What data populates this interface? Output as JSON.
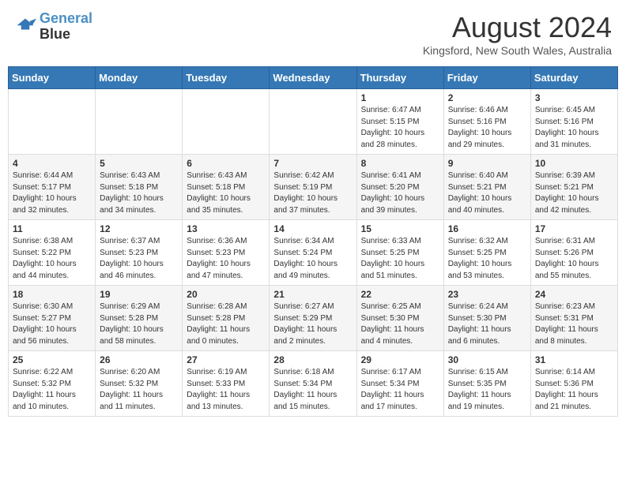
{
  "logo": {
    "line1": "General",
    "line2": "Blue"
  },
  "title": "August 2024",
  "location": "Kingsford, New South Wales, Australia",
  "days_header": [
    "Sunday",
    "Monday",
    "Tuesday",
    "Wednesday",
    "Thursday",
    "Friday",
    "Saturday"
  ],
  "weeks": [
    [
      {
        "day": "",
        "text": ""
      },
      {
        "day": "",
        "text": ""
      },
      {
        "day": "",
        "text": ""
      },
      {
        "day": "",
        "text": ""
      },
      {
        "day": "1",
        "text": "Sunrise: 6:47 AM\nSunset: 5:15 PM\nDaylight: 10 hours\nand 28 minutes."
      },
      {
        "day": "2",
        "text": "Sunrise: 6:46 AM\nSunset: 5:16 PM\nDaylight: 10 hours\nand 29 minutes."
      },
      {
        "day": "3",
        "text": "Sunrise: 6:45 AM\nSunset: 5:16 PM\nDaylight: 10 hours\nand 31 minutes."
      }
    ],
    [
      {
        "day": "4",
        "text": "Sunrise: 6:44 AM\nSunset: 5:17 PM\nDaylight: 10 hours\nand 32 minutes."
      },
      {
        "day": "5",
        "text": "Sunrise: 6:43 AM\nSunset: 5:18 PM\nDaylight: 10 hours\nand 34 minutes."
      },
      {
        "day": "6",
        "text": "Sunrise: 6:43 AM\nSunset: 5:18 PM\nDaylight: 10 hours\nand 35 minutes."
      },
      {
        "day": "7",
        "text": "Sunrise: 6:42 AM\nSunset: 5:19 PM\nDaylight: 10 hours\nand 37 minutes."
      },
      {
        "day": "8",
        "text": "Sunrise: 6:41 AM\nSunset: 5:20 PM\nDaylight: 10 hours\nand 39 minutes."
      },
      {
        "day": "9",
        "text": "Sunrise: 6:40 AM\nSunset: 5:21 PM\nDaylight: 10 hours\nand 40 minutes."
      },
      {
        "day": "10",
        "text": "Sunrise: 6:39 AM\nSunset: 5:21 PM\nDaylight: 10 hours\nand 42 minutes."
      }
    ],
    [
      {
        "day": "11",
        "text": "Sunrise: 6:38 AM\nSunset: 5:22 PM\nDaylight: 10 hours\nand 44 minutes."
      },
      {
        "day": "12",
        "text": "Sunrise: 6:37 AM\nSunset: 5:23 PM\nDaylight: 10 hours\nand 46 minutes."
      },
      {
        "day": "13",
        "text": "Sunrise: 6:36 AM\nSunset: 5:23 PM\nDaylight: 10 hours\nand 47 minutes."
      },
      {
        "day": "14",
        "text": "Sunrise: 6:34 AM\nSunset: 5:24 PM\nDaylight: 10 hours\nand 49 minutes."
      },
      {
        "day": "15",
        "text": "Sunrise: 6:33 AM\nSunset: 5:25 PM\nDaylight: 10 hours\nand 51 minutes."
      },
      {
        "day": "16",
        "text": "Sunrise: 6:32 AM\nSunset: 5:25 PM\nDaylight: 10 hours\nand 53 minutes."
      },
      {
        "day": "17",
        "text": "Sunrise: 6:31 AM\nSunset: 5:26 PM\nDaylight: 10 hours\nand 55 minutes."
      }
    ],
    [
      {
        "day": "18",
        "text": "Sunrise: 6:30 AM\nSunset: 5:27 PM\nDaylight: 10 hours\nand 56 minutes."
      },
      {
        "day": "19",
        "text": "Sunrise: 6:29 AM\nSunset: 5:28 PM\nDaylight: 10 hours\nand 58 minutes."
      },
      {
        "day": "20",
        "text": "Sunrise: 6:28 AM\nSunset: 5:28 PM\nDaylight: 11 hours\nand 0 minutes."
      },
      {
        "day": "21",
        "text": "Sunrise: 6:27 AM\nSunset: 5:29 PM\nDaylight: 11 hours\nand 2 minutes."
      },
      {
        "day": "22",
        "text": "Sunrise: 6:25 AM\nSunset: 5:30 PM\nDaylight: 11 hours\nand 4 minutes."
      },
      {
        "day": "23",
        "text": "Sunrise: 6:24 AM\nSunset: 5:30 PM\nDaylight: 11 hours\nand 6 minutes."
      },
      {
        "day": "24",
        "text": "Sunrise: 6:23 AM\nSunset: 5:31 PM\nDaylight: 11 hours\nand 8 minutes."
      }
    ],
    [
      {
        "day": "25",
        "text": "Sunrise: 6:22 AM\nSunset: 5:32 PM\nDaylight: 11 hours\nand 10 minutes."
      },
      {
        "day": "26",
        "text": "Sunrise: 6:20 AM\nSunset: 5:32 PM\nDaylight: 11 hours\nand 11 minutes."
      },
      {
        "day": "27",
        "text": "Sunrise: 6:19 AM\nSunset: 5:33 PM\nDaylight: 11 hours\nand 13 minutes."
      },
      {
        "day": "28",
        "text": "Sunrise: 6:18 AM\nSunset: 5:34 PM\nDaylight: 11 hours\nand 15 minutes."
      },
      {
        "day": "29",
        "text": "Sunrise: 6:17 AM\nSunset: 5:34 PM\nDaylight: 11 hours\nand 17 minutes."
      },
      {
        "day": "30",
        "text": "Sunrise: 6:15 AM\nSunset: 5:35 PM\nDaylight: 11 hours\nand 19 minutes."
      },
      {
        "day": "31",
        "text": "Sunrise: 6:14 AM\nSunset: 5:36 PM\nDaylight: 11 hours\nand 21 minutes."
      }
    ]
  ]
}
